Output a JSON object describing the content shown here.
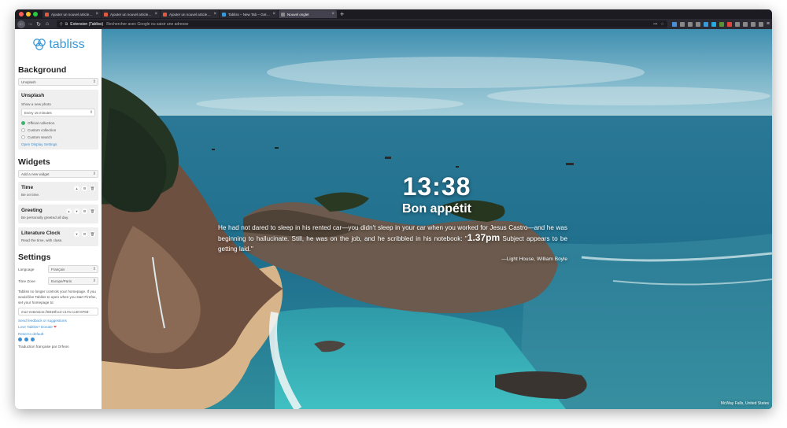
{
  "browser": {
    "tabs": [
      {
        "title": "Ajouter un nouvel article ‹ Nou...",
        "favicon_color": "#e05a3f",
        "active": false
      },
      {
        "title": "Ajouter un nouvel article ‹ Nou...",
        "favicon_color": "#e05a3f",
        "active": false
      },
      {
        "title": "Ajouter un nouvel article ‹ Nou...",
        "favicon_color": "#e05a3f",
        "active": false
      },
      {
        "title": "Tabliss – New Tab – Get this E...",
        "favicon_color": "#3a9ad9",
        "active": false
      },
      {
        "title": "Nouvel onglet",
        "favicon_color": "#888888",
        "active": true
      }
    ],
    "new_tab_symbol": "+",
    "url_extension_label": "Extension (Tabliss)",
    "url_placeholder": "Rechercher avec Google ou saisir une adresse"
  },
  "sidebar": {
    "logo_text": "tabliss",
    "background": {
      "title": "Background",
      "source_value": "Unsplash",
      "panel_title": "Unsplash",
      "show_new_photo_label": "Show a new photo",
      "frequency_value": "Every 15 minutes",
      "options": [
        {
          "label": "Official collection",
          "selected": true
        },
        {
          "label": "Custom collection",
          "selected": false
        },
        {
          "label": "Custom search",
          "selected": false
        }
      ],
      "display_settings_link": "Open Display Settings"
    },
    "widgets": {
      "title": "Widgets",
      "add_placeholder": "Add a new widget",
      "items": [
        {
          "title": "Time",
          "desc": "Be on time."
        },
        {
          "title": "Greeting",
          "desc": "Be personally greeted all day."
        },
        {
          "title": "Literature Clock",
          "desc": "Read the time, with class."
        }
      ]
    },
    "settings": {
      "title": "Settings",
      "language_label": "Language",
      "language_value": "Français",
      "timezone_label": "Time Zone",
      "timezone_value": "Europe/Paris",
      "homepage_note": "Tabliss no longer controls your homepage. If you would like Tabliss to open when you start Firefox, set your homepage to:",
      "homepage_url": "moz-extension://6819f1c2-c17a-cc40-8783-",
      "feedback_link": "Send feedback or suggestions",
      "donate_link": "Love Tabliss? Donate",
      "reset_link": "Reset to default",
      "translation_credit": "Traduction française par Orfeon"
    }
  },
  "dashboard": {
    "time": "13:38",
    "greeting": "Bon appétit",
    "quote_before": "He had not dared to sleep in his rented car—you didn't sleep in your car when you worked for Jesus Castro—and he was beginning to hallucinate. Still, he was on the job, and he scribbled in his notebook: \"",
    "quote_time": "1.37pm",
    "quote_after": " Subject appears to be getting laid.\"",
    "quote_source": "—Light House, William Boyle",
    "photo_credit": "McWay Falls, United States"
  },
  "colors": {
    "accent": "#3a9ad9",
    "toggle_on": "#3cb371",
    "browser_dark": "#2b2a33"
  }
}
